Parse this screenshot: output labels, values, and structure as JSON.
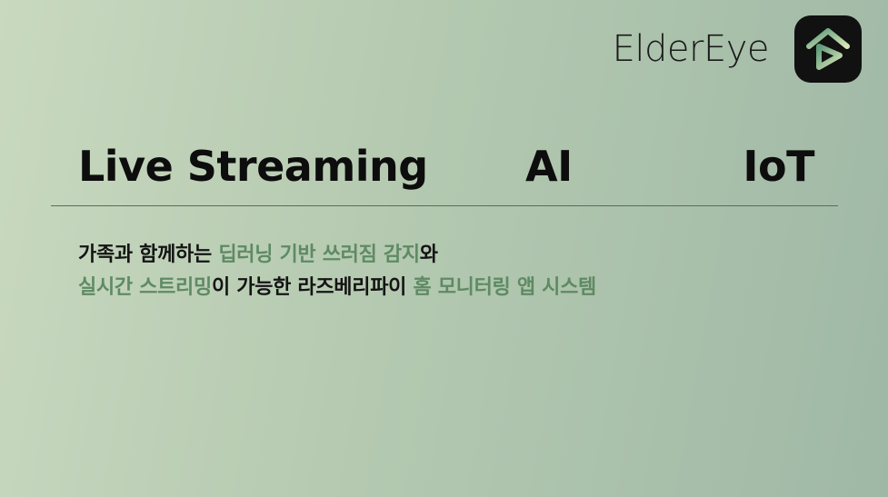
{
  "brand": {
    "name": "ElderEye",
    "logo_icon": "home-heart-icon"
  },
  "keywords": {
    "live": "Live Streaming",
    "ai": "AI",
    "iot": "IoT"
  },
  "description": {
    "line1": {
      "part1": "가족과 함께하는 ",
      "part2": "딥러닝 기반 쓰러짐 감지",
      "part3": "와"
    },
    "line2": {
      "part1": "실시간 스트리밍",
      "part2": "이 가능한 라즈베리파이 ",
      "part3": "홈 모니터링 앱 시스템"
    }
  },
  "colors": {
    "highlight": "#5e8a64",
    "text": "#141414",
    "logo_bg": "#111111"
  }
}
